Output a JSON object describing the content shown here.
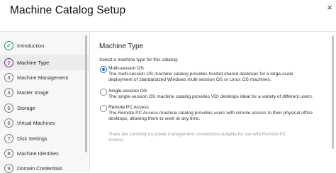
{
  "window": {
    "title": "Machine Catalog Setup",
    "close_glyph": "×"
  },
  "steps": [
    {
      "number": "✓",
      "label": "Introduction",
      "state": "done"
    },
    {
      "number": "2",
      "label": "Machine Type",
      "state": "current"
    },
    {
      "number": "3",
      "label": "Machine Management",
      "state": "pending"
    },
    {
      "number": "4",
      "label": "Master Image",
      "state": "pending"
    },
    {
      "number": "5",
      "label": "Storage",
      "state": "pending"
    },
    {
      "number": "6",
      "label": "Virtual Machines",
      "state": "pending"
    },
    {
      "number": "7",
      "label": "Disk Settings",
      "state": "pending"
    },
    {
      "number": "8",
      "label": "Machine Identities",
      "state": "pending"
    },
    {
      "number": "9",
      "label": "Domain Credentials",
      "state": "pending"
    }
  ],
  "main": {
    "section_title": "Machine Type",
    "prompt": "Select a machine type for this catalog:",
    "options": [
      {
        "name": "Multi-session OS",
        "selected": true,
        "desc_lines": [
          "The multi-session OS machine catalog provides hosted shared desktops for a large-scale",
          "deployment of standardized Windows multi-session OS or Linux OS machines."
        ]
      },
      {
        "name": "Single-session OS",
        "selected": false,
        "desc_lines": [
          "The single-session OS machine catalog provides VDI desktops ideal for a variety of different users."
        ]
      },
      {
        "name": "Remote PC Access",
        "selected": false,
        "desc_lines": [
          "The Remote PC Access machine catalog provides users with remote access to their physical office",
          "desktops, allowing them to work at any time."
        ]
      }
    ],
    "note_lines": [
      "There are currently no power management connections suitable for use with Remote PC",
      "Access."
    ]
  },
  "colors": {
    "accent": "#1a6fb5",
    "done": "#1b9e64",
    "current": "#6a2c91"
  }
}
